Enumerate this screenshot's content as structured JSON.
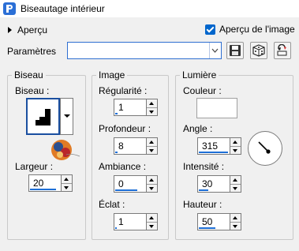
{
  "window": {
    "title": "Biseautage intérieur"
  },
  "header": {
    "preview_toggle_label": "Aperçu",
    "preview_checkbox_label": "Aperçu de l'image",
    "preview_checked": true
  },
  "params": {
    "label": "Paramètres",
    "value": ""
  },
  "bevel_group": {
    "title": "Biseau",
    "bevel_label": "Biseau :",
    "width_label": "Largeur :",
    "width_value": "20"
  },
  "image_group": {
    "title": "Image",
    "smoothness_label": "Régularité :",
    "smoothness_value": "1",
    "depth_label": "Profondeur :",
    "depth_value": "8",
    "ambience_label": "Ambiance :",
    "ambience_value": "0",
    "shine_label": "Éclat :",
    "shine_value": "1"
  },
  "light_group": {
    "title": "Lumière",
    "color_label": "Couleur :",
    "color": "#ffffff",
    "angle_label": "Angle :",
    "angle_value": "315",
    "intensity_label": "Intensité :",
    "intensity_value": "30",
    "elevation_label": "Hauteur :",
    "elevation_value": "50"
  },
  "icons": [
    "app-icon",
    "save-preset-icon",
    "randomize-icon",
    "reset-icon",
    "bevel-shape-icon",
    "watermark-logo",
    "light-direction-dial"
  ],
  "colors": {
    "accent": "#0066cc",
    "focus_border": "#2f6fd1",
    "slider_fill": "#1e6fd6"
  }
}
